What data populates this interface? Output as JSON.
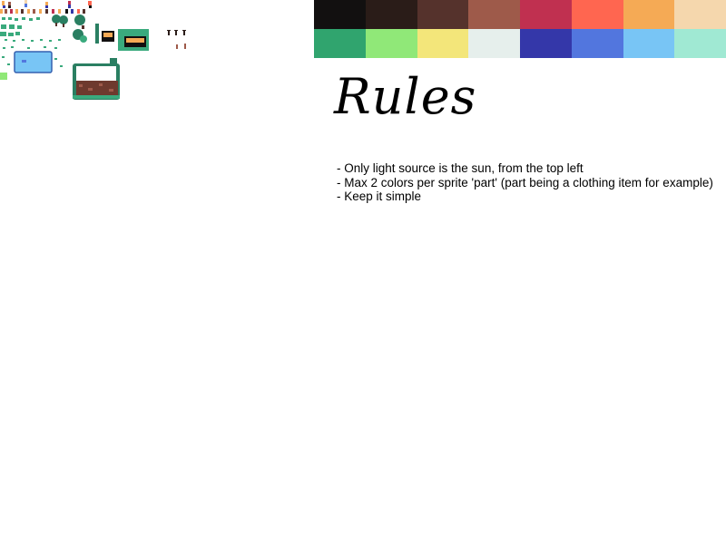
{
  "palette": [
    "#121010",
    "#2a1c18",
    "#55322c",
    "#9e5a4a",
    "#c03050",
    "#ff6650",
    "#f5aa55",
    "#f5d7ad",
    "#30a46e",
    "#90e878",
    "#f3e67a",
    "#e6efec",
    "#3437a9",
    "#5276de",
    "#78c5f5",
    "#a0e9d3"
  ],
  "sprite_colors": {
    "dark_green": "#2a7f62",
    "mid_green": "#3aaa7d",
    "light_green": "#90e878",
    "water": "#78c5f5",
    "water_edge": "#3460b0",
    "dirt": "#6e3a2e",
    "gold": "#f5aa55",
    "dark": "#121010"
  },
  "rules": {
    "heading": "Rules",
    "items": [
      "- Only light source is the sun, from the top left",
      "- Max 2 colors per sprite 'part' (part being a clothing item for example)",
      "- Keep it simple"
    ]
  }
}
